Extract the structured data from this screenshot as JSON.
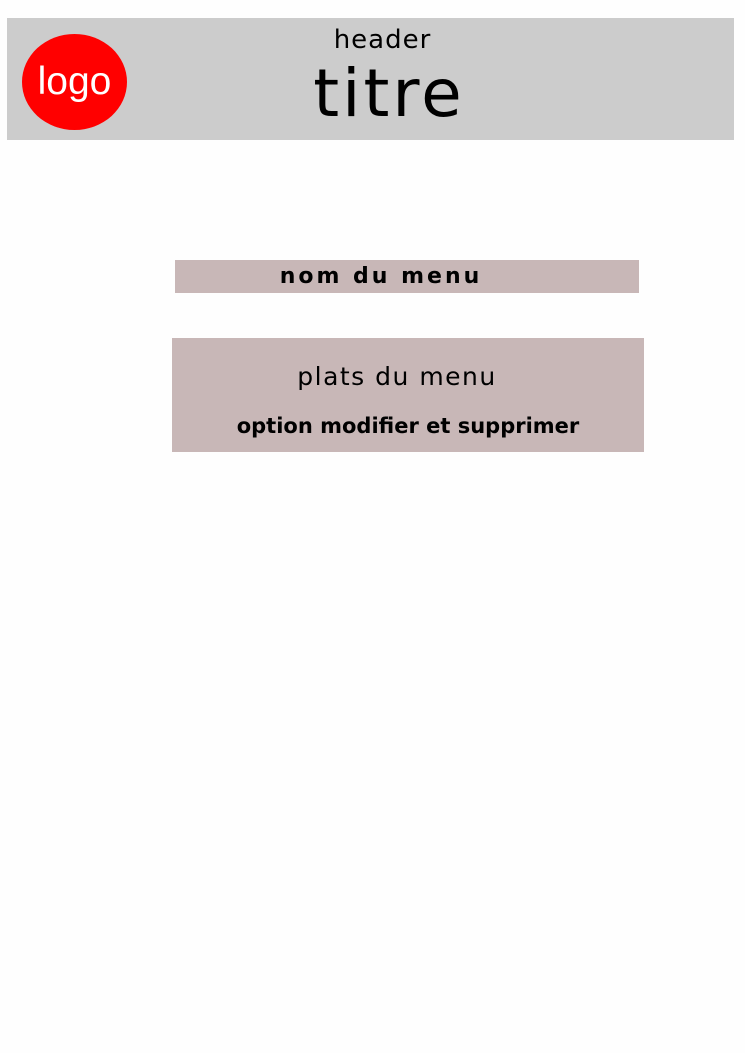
{
  "header": {
    "label": "header",
    "title": "titre",
    "logo_text": "logo"
  },
  "menu": {
    "name_label": "nom du menu",
    "dishes_label": "plats du menu",
    "options_label": "option modifier et supprimer"
  },
  "colors": {
    "header_background": "#cccccc",
    "logo_background": "#ff0000",
    "logo_text": "#ffffff",
    "menu_box_background": "#c8b7b7",
    "page_background": "#fefefe"
  }
}
